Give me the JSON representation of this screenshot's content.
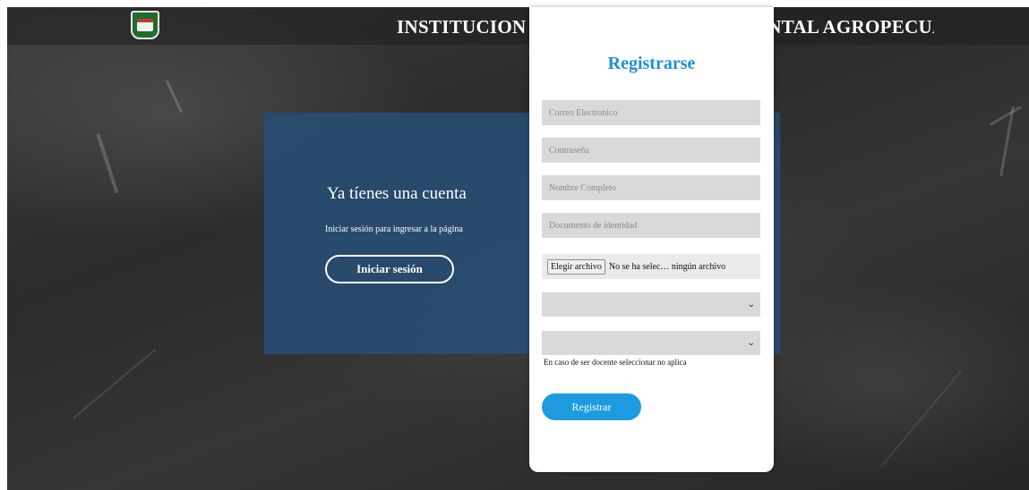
{
  "header": {
    "title": "INSTITUCION EDUCATIVA DEPARTAMENTAL AGROPECUARIA PILOTO",
    "logo_icon": "school-crest-icon"
  },
  "login_panel": {
    "heading": "Ya tíenes una cuenta",
    "subtext": "Iniciar sesión para ingresar a la página",
    "button_label": "Iniciar sesión"
  },
  "register_form": {
    "title": "Registrarse",
    "email_placeholder": "Correo Electronico",
    "password_placeholder": "Contraseña",
    "name_placeholder": "Nombre Completo",
    "document_placeholder": "Documento de identidad",
    "file_button_label": "Elegir archivo",
    "file_status": "No se ha selec… ningún archivo",
    "select1_value": "",
    "select2_value": "",
    "hint": "En caso de ser docente seleccionar no aplica",
    "submit_label": "Registrar"
  },
  "colors": {
    "accent": "#1e90d8",
    "panel_blue": "#264e76",
    "field_gray": "#d9d9d9"
  }
}
